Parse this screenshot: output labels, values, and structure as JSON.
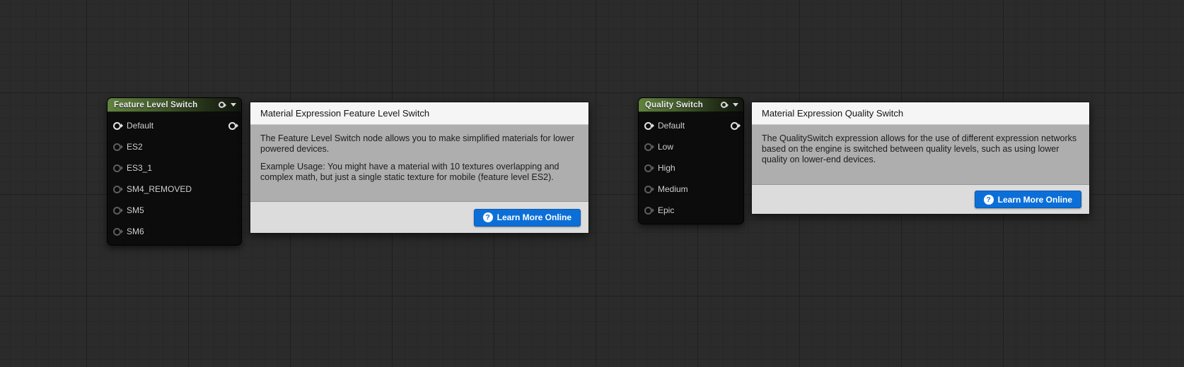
{
  "nodes": {
    "feature": {
      "title": "Feature Level Switch",
      "pins": [
        "Default",
        "ES2",
        "ES3_1",
        "SM4_REMOVED",
        "SM5",
        "SM6"
      ]
    },
    "quality": {
      "title": "Quality Switch",
      "pins": [
        "Default",
        "Low",
        "High",
        "Medium",
        "Epic"
      ]
    }
  },
  "tooltips": {
    "feature": {
      "title": "Material Expression Feature Level Switch",
      "paragraphs": [
        "The Feature Level Switch node allows you to make simplified materials for lower powered devices.",
        "Example Usage: You might have a material with 10 textures overlapping and complex math, but just a single static texture for mobile (feature level ES2)."
      ],
      "learn_more": "Learn More Online"
    },
    "quality": {
      "title": "Material Expression Quality Switch",
      "paragraphs": [
        "The QualitySwitch expression allows for the use of different expression networks based on the engine is switched between quality levels, such as using lower quality on lower-end devices."
      ],
      "learn_more": "Learn More Online"
    }
  },
  "icons": {
    "question": "?"
  },
  "colors": {
    "canvas_bg": "#2b2b2b",
    "header_green": "#61823f",
    "button_blue": "#0c6fd8"
  }
}
